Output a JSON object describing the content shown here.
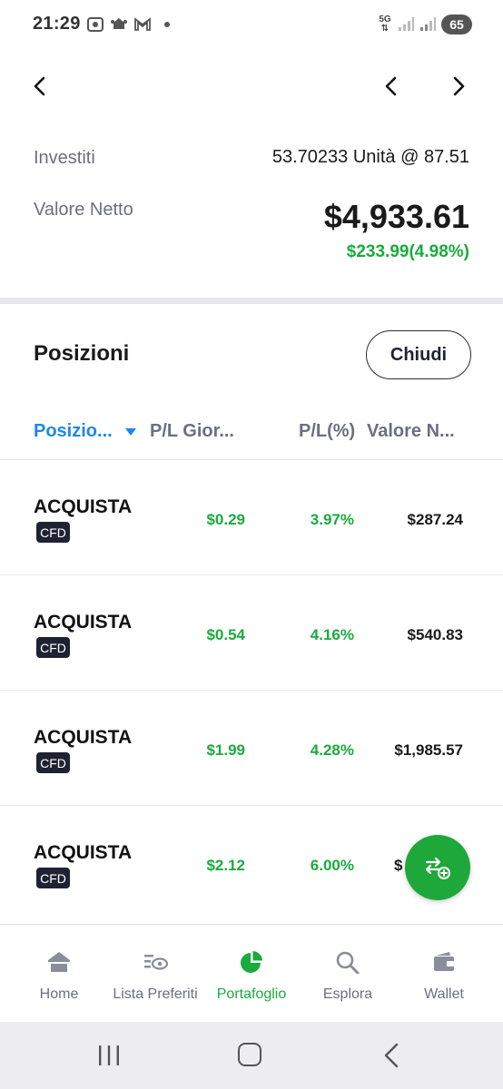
{
  "status_bar": {
    "time": "21:29",
    "network": "5G",
    "battery": "65",
    "icons": [
      "screenshot-icon",
      "bug-icon",
      "gmail-icon",
      "notification-dot"
    ]
  },
  "header": {
    "back_icon": "chevron-left-icon",
    "prev_icon": "chevron-left-icon",
    "next_icon": "chevron-right-icon"
  },
  "summary": {
    "invested_label": "Investiti",
    "invested_value": "53.70233 Unità @ 87.51",
    "net_label": "Valore Netto",
    "net_value": "$4,933.61",
    "net_pl": "$233.99(4.98%)"
  },
  "positions": {
    "title": "Posizioni",
    "close_label": "Chiudi",
    "columns": {
      "position": "Posizio...",
      "daily_pl": "P/L Gior...",
      "pl_percent": "P/L(%)",
      "net_value": "Valore N..."
    },
    "rows": [
      {
        "side": "ACQUISTA",
        "tag": "CFD",
        "daily_pl": "$0.29",
        "pl_percent": "3.97%",
        "net_value": "$287.24"
      },
      {
        "side": "ACQUISTA",
        "tag": "CFD",
        "daily_pl": "$0.54",
        "pl_percent": "4.16%",
        "net_value": "$540.83"
      },
      {
        "side": "ACQUISTA",
        "tag": "CFD",
        "daily_pl": "$1.99",
        "pl_percent": "4.28%",
        "net_value": "$1,985.57"
      },
      {
        "side": "ACQUISTA",
        "tag": "CFD",
        "daily_pl": "$2.12",
        "pl_percent": "6.00%",
        "net_value": "$"
      }
    ]
  },
  "fab": {
    "icon": "trade-add-icon"
  },
  "bottom_nav": {
    "items": [
      {
        "label": "Home",
        "icon": "home-icon"
      },
      {
        "label": "Lista Preferiti",
        "icon": "watchlist-icon"
      },
      {
        "label": "Portafoglio",
        "icon": "pie-chart-icon",
        "active": true
      },
      {
        "label": "Esplora",
        "icon": "search-icon"
      },
      {
        "label": "Wallet",
        "icon": "wallet-icon"
      }
    ]
  },
  "colors": {
    "accent_green": "#1aab3c",
    "accent_blue": "#1e88e5",
    "muted_text": "#6b6f80"
  }
}
